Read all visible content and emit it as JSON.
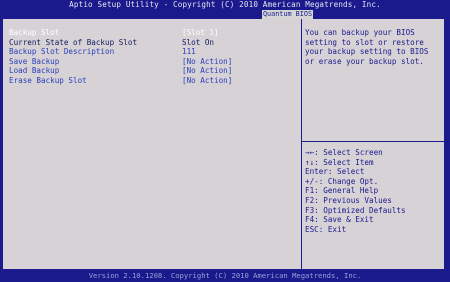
{
  "header": {
    "title": "Aptio Setup Utility - Copyright (C) 2010 American Megatrends, Inc.",
    "tab": "Quantum BIOS"
  },
  "settings": [
    {
      "label": "Backup Slot",
      "value": "[Slot 1]"
    },
    {
      "label": "Current State of Backup Slot",
      "value": "Slot On"
    },
    {
      "label": "Backup Slot Description",
      "value": "111"
    },
    {
      "label": "Save Backup",
      "value": "[No Action]"
    },
    {
      "label": "Load Backup",
      "value": "[No Action]"
    },
    {
      "label": "Erase Backup Slot",
      "value": "[No Action]"
    }
  ],
  "help": {
    "text": "You can backup your BIOS setting to slot or restore your backup setting to BIOS or erase your backup slot."
  },
  "keys": [
    "→←: Select Screen",
    "↑↓: Select Item",
    "Enter: Select",
    "+/-: Change Opt.",
    "F1: General Help",
    "F2: Previous Values",
    "F3: Optimized Defaults",
    "F4: Save & Exit",
    "ESC: Exit"
  ],
  "footer": {
    "text": "Version 2.10.1208. Copyright (C) 2010 American Megatrends, Inc."
  },
  "colors": {
    "background": "#1a1a8c",
    "panel": "#d7d2d6",
    "highlight": "#ffffff",
    "option_text": "#2a3fb8"
  }
}
